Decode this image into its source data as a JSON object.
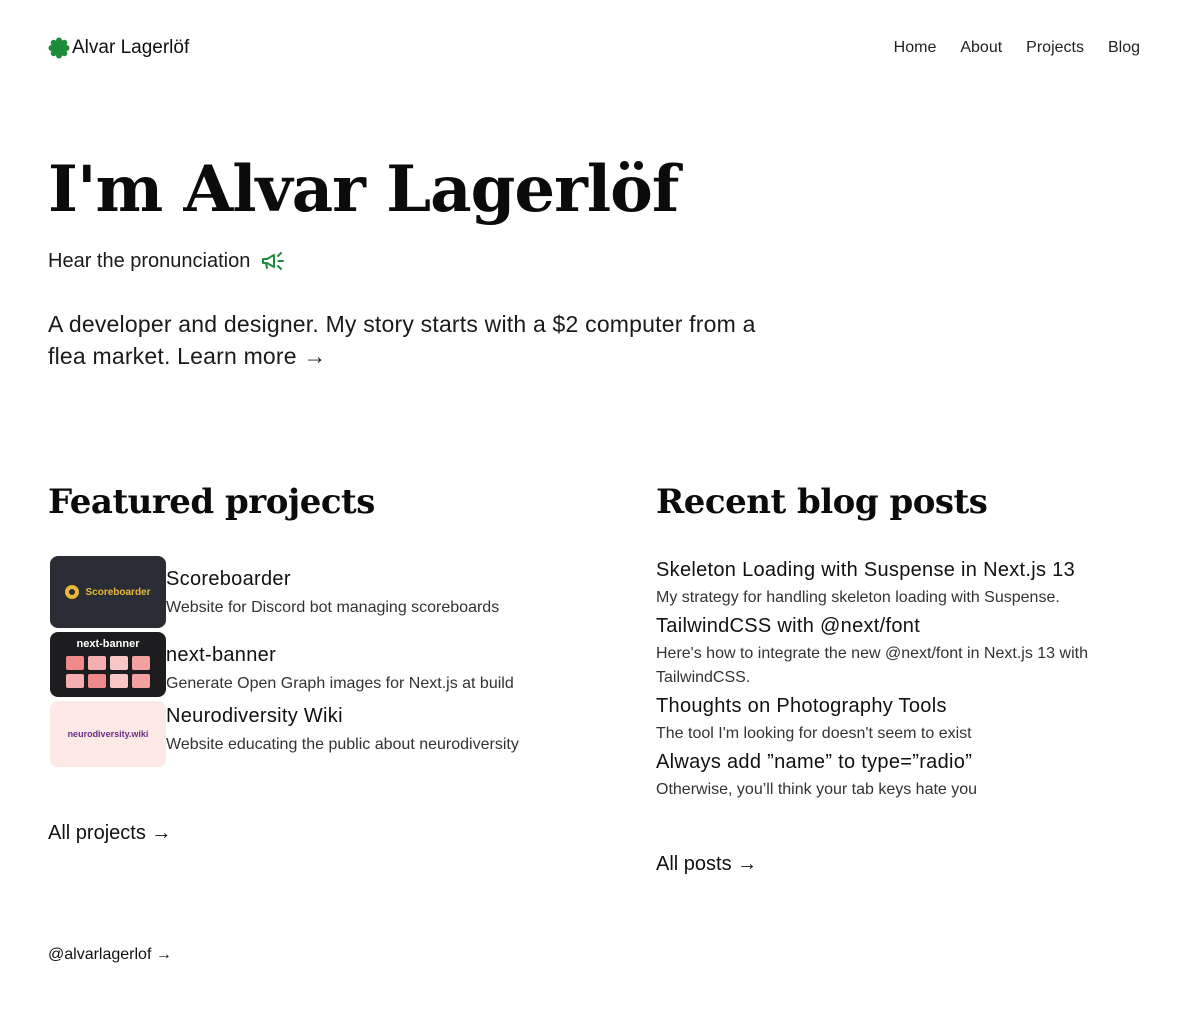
{
  "header": {
    "brand": "Alvar Lagerlöf",
    "nav": [
      "Home",
      "About",
      "Projects",
      "Blog"
    ],
    "accent": "#1f8a3b"
  },
  "hero": {
    "title": "I'm Alvar Lagerlöf",
    "pronounce": "Hear the pronunciation",
    "intro": "A developer and designer. My story starts with a $2 computer from a flea market.",
    "learn_more": "Learn more →"
  },
  "projects": {
    "title": "Featured projects",
    "items": [
      {
        "name": "Scoreboarder",
        "desc": "Website for Discord bot managing scoreboards",
        "thumb_text": "Scoreboarder",
        "thumb_bg": "#2b2d36"
      },
      {
        "name": "next-banner",
        "desc": "Generate Open Graph images for Next.js at build",
        "thumb_text": "next-banner",
        "thumb_bg": "#1d1d1f"
      },
      {
        "name": "Neurodiversity Wiki",
        "desc": "Website educating the public about neurodiversity",
        "thumb_text": "neurodiversity.wiki",
        "thumb_bg": "#fce8e4"
      }
    ],
    "all": "All projects →"
  },
  "posts": {
    "title": "Recent blog posts",
    "items": [
      {
        "title": "Skeleton Loading with Suspense in Next.js 13",
        "desc": "My strategy for handling skeleton loading with Suspense."
      },
      {
        "title": "TailwindCSS with @next/font",
        "desc": "Here's how to integrate the new @next/font in Next.js 13 with TailwindCSS."
      },
      {
        "title": "Thoughts on Photography Tools",
        "desc": "The tool I'm looking for doesn't seem to exist"
      },
      {
        "title": "Always add ”name” to type=”radio”",
        "desc": "Otherwise, you’ll think your tab keys hate you"
      }
    ],
    "all": "All posts →"
  },
  "footer": {
    "social": "@alvarlagerlof →"
  },
  "icons": {
    "logo": "flower-icon",
    "pronounce": "megaphone-icon"
  }
}
